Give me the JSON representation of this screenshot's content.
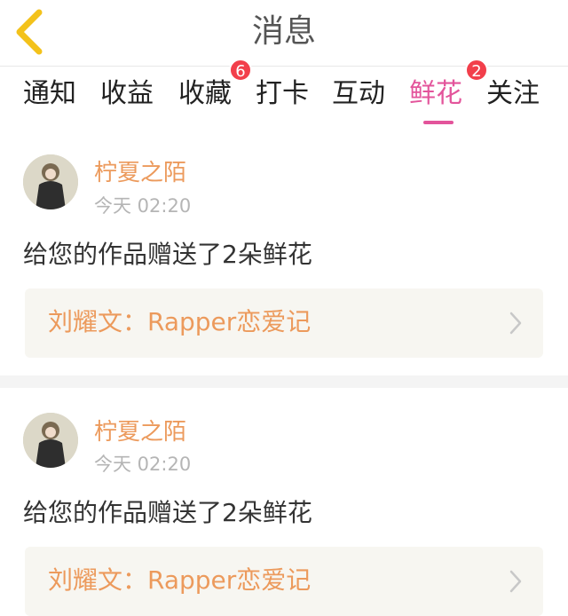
{
  "header": {
    "title": "消息",
    "back_icon": "chevron-left-icon"
  },
  "tabs": [
    {
      "label": "通知",
      "badge": ""
    },
    {
      "label": "收益",
      "badge": ""
    },
    {
      "label": "收藏",
      "badge": "6"
    },
    {
      "label": "打卡",
      "badge": ""
    },
    {
      "label": "互动",
      "badge": ""
    },
    {
      "label": "鲜花",
      "badge": "2",
      "active": true
    },
    {
      "label": "关注",
      "badge": ""
    }
  ],
  "accent_color": "#e3549b",
  "messages": [
    {
      "username": "柠夏之陌",
      "time": "今天 02:20",
      "text": "给您的作品赠送了2朵鲜花",
      "work_title": "刘耀文：Rapper恋爱记"
    },
    {
      "username": "柠夏之陌",
      "time": "今天 02:20",
      "text": "给您的作品赠送了2朵鲜花",
      "work_title": "刘耀文：Rapper恋爱记"
    }
  ]
}
